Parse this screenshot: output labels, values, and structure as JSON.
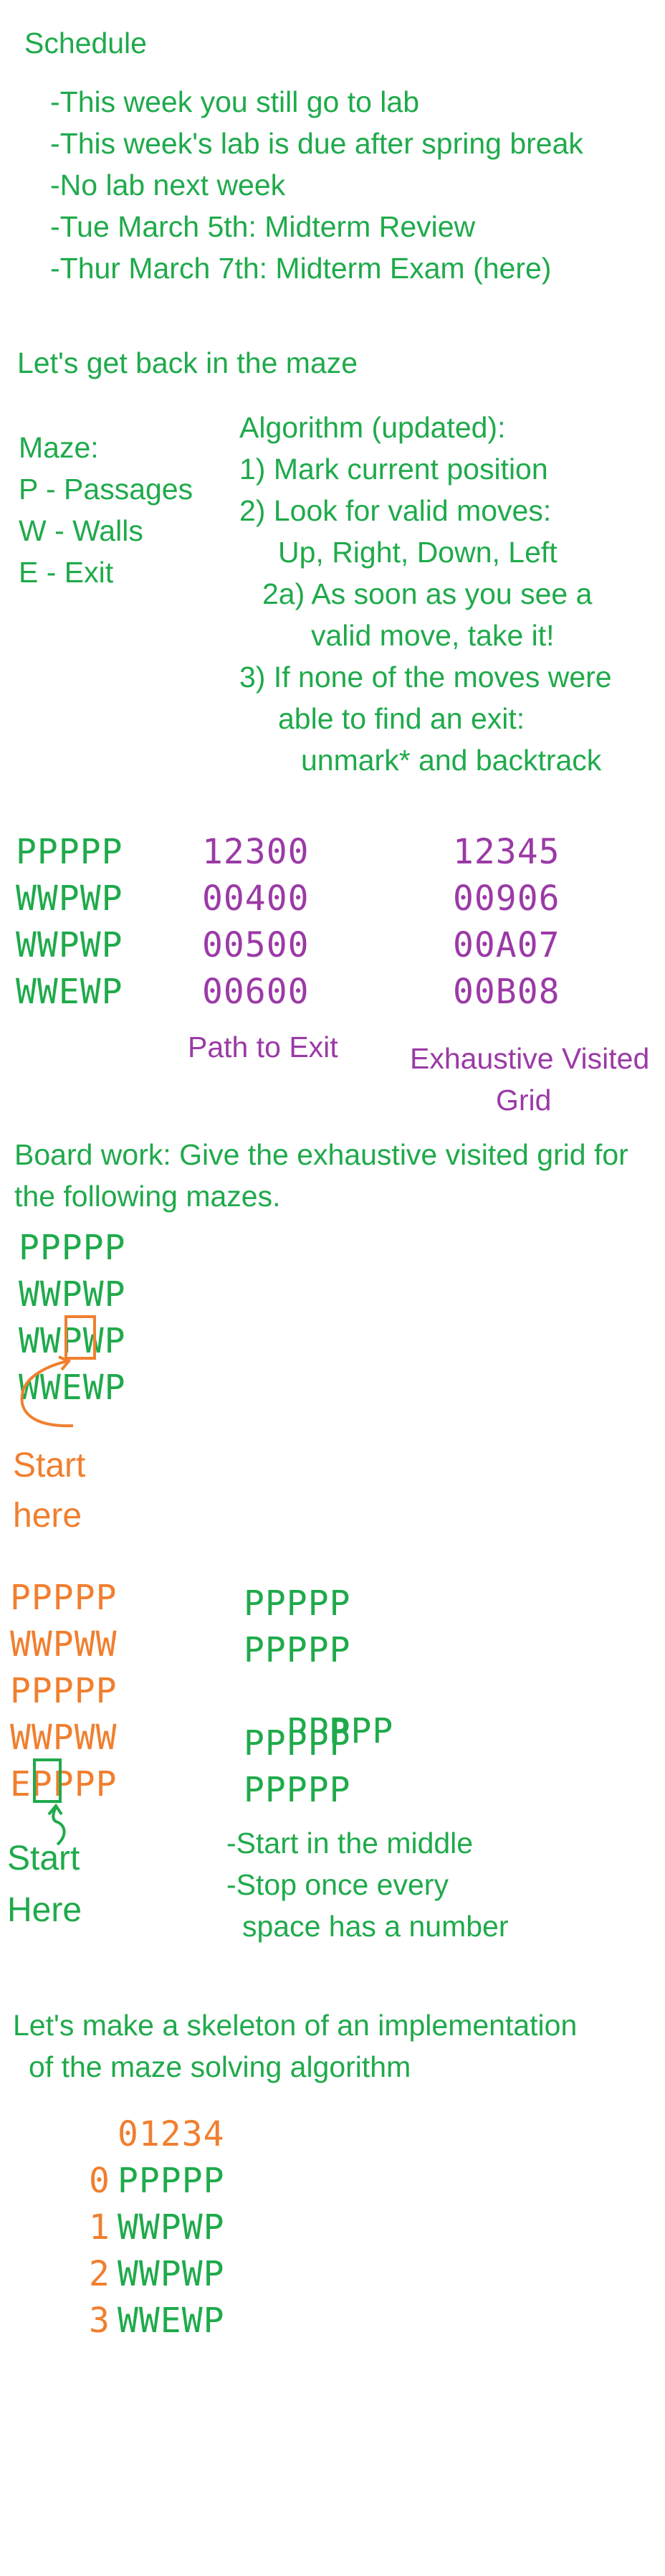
{
  "schedule": {
    "title": "Schedule",
    "items": [
      "-This week you still go to lab",
      "-This week's lab is due after spring break",
      "-No lab next week",
      "-Tue March 5th: Midterm Review",
      "-Thur March 7th: Midterm Exam (here)"
    ]
  },
  "maze_intro": "Let's get back in the maze",
  "legend": {
    "title": "Maze:",
    "items": [
      "P - Passages",
      "W - Walls",
      "E - Exit"
    ]
  },
  "algorithm": {
    "lines": [
      "Algorithm (updated):",
      "1) Mark current position",
      "2) Look for valid moves:",
      "Up, Right, Down, Left",
      "2a) As soon as you see a",
      "valid move, take it!",
      "3) If none of the moves were",
      "able to find an exit:",
      "unmark* and backtrack"
    ]
  },
  "example": {
    "maze_rows": [
      "PPPPP",
      "WWPWP",
      "WWPWP",
      "WWEWP"
    ],
    "path_rows": [
      "12300",
      "00400",
      "00500",
      "00600"
    ],
    "visited_rows": [
      "12345",
      "00906",
      "00A07",
      "00B08"
    ],
    "path_label": "Path to Exit",
    "visited_label_1": "Exhaustive Visited",
    "visited_label_2": "Grid"
  },
  "board_work": {
    "line1": "Board work: Give the exhaustive visited grid for",
    "line2": "the following mazes."
  },
  "maze_a": {
    "rows": [
      "PPPPP",
      "WWPWP",
      "WWPWP",
      "WWEWP"
    ],
    "start_1": "Start",
    "start_2": "here"
  },
  "maze_b": {
    "rows": [
      "PPPPP",
      "WWPWW",
      "PPPPP",
      "WWPWW",
      "EPPPP"
    ],
    "start_1": "Start",
    "start_2": "Here"
  },
  "maze_c": {
    "rows_plain": [
      "PPPPP",
      "PPPPP",
      "PPPPP",
      "PPPPP"
    ],
    "middle_left": "PP",
    "middle_bold": "P",
    "middle_right": "PP",
    "notes": [
      "-Start in the middle",
      "-Stop once every",
      "space has a number"
    ]
  },
  "skeleton": {
    "line1": "Let's make a skeleton of an implementation",
    "line2": "of the maze solving algorithm",
    "col_header": "01234",
    "row_indices": [
      "0",
      "1",
      "2",
      "3"
    ],
    "rows": [
      "PPPPP",
      "WWPWP",
      "WWPWP",
      "WWEWP"
    ]
  },
  "colors": {
    "green": "#1faa4b",
    "purple": "#9b3aa6",
    "orange": "#f07f2f"
  }
}
